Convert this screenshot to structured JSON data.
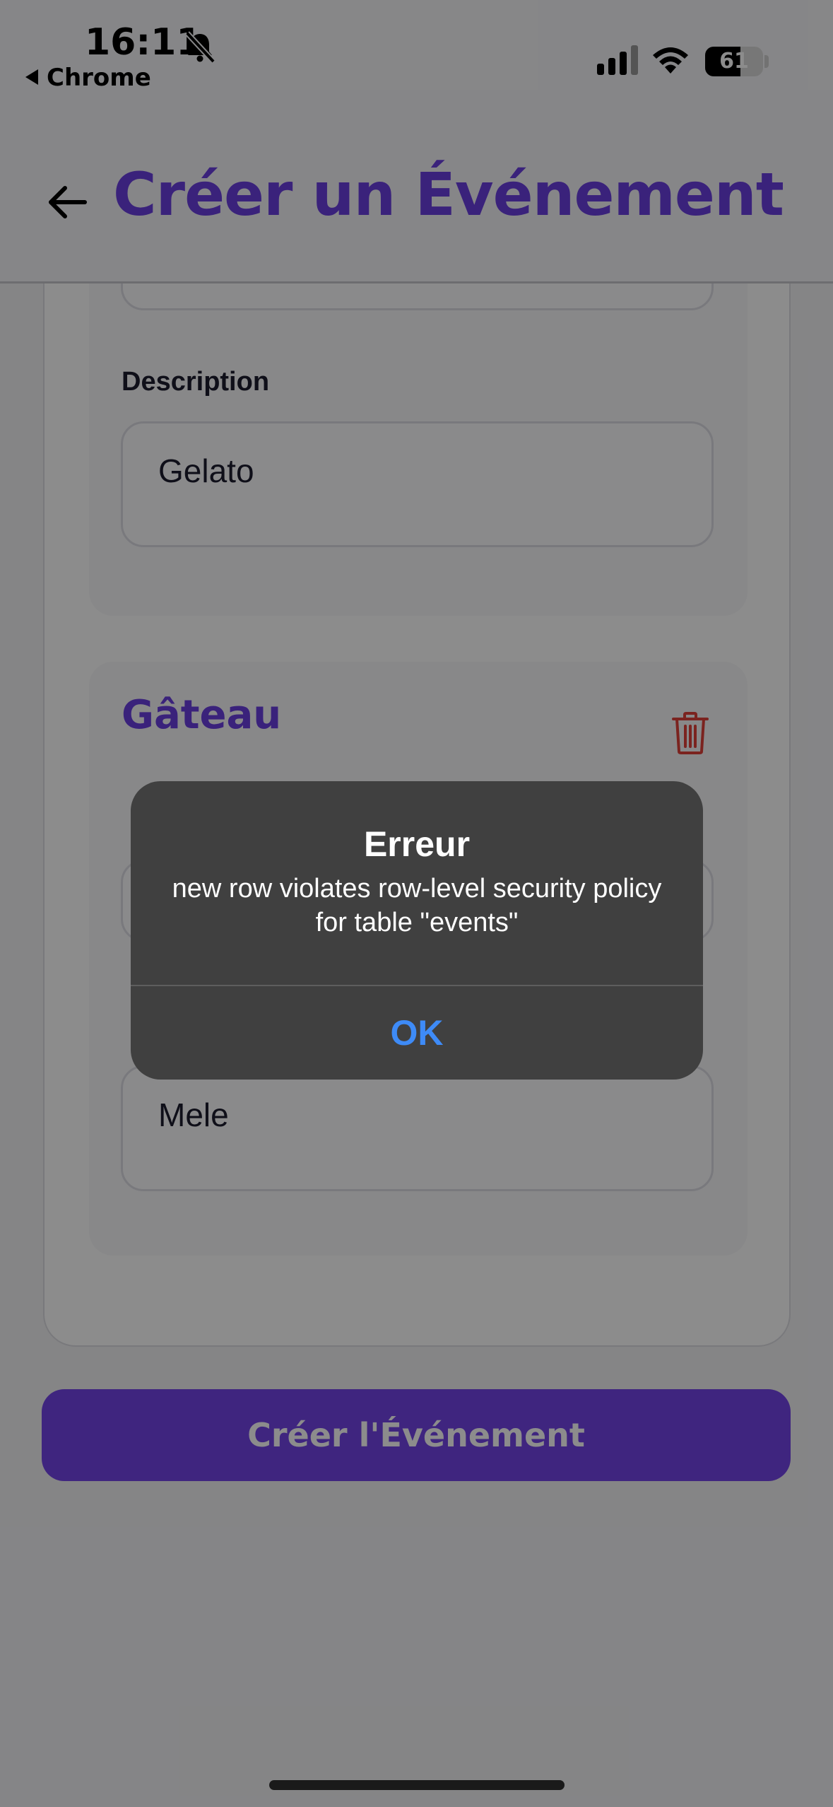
{
  "status_bar": {
    "time": "16:11",
    "back_app": "Chrome",
    "battery_percent": "61",
    "battery_level": 0.61
  },
  "header": {
    "title": "Créer un Événement"
  },
  "form": {
    "section_a": {
      "description_label": "Description",
      "description_value": "Gelato"
    },
    "section_b": {
      "title": "Gâteau",
      "description_value": "Mele"
    },
    "submit_label": "Créer l'Événement"
  },
  "alert": {
    "title": "Erreur",
    "message": "new row violates row-level security policy for table \"events\"",
    "ok_label": "OK"
  },
  "colors": {
    "accent": "#6b3fe0",
    "button": "#7444e8",
    "alert_link": "#3e8bf7",
    "danger": "#e0403a"
  },
  "icons": [
    "bell-slash-icon",
    "signal-icon",
    "wifi-icon",
    "battery-icon",
    "arrow-left-icon",
    "trash-icon"
  ]
}
